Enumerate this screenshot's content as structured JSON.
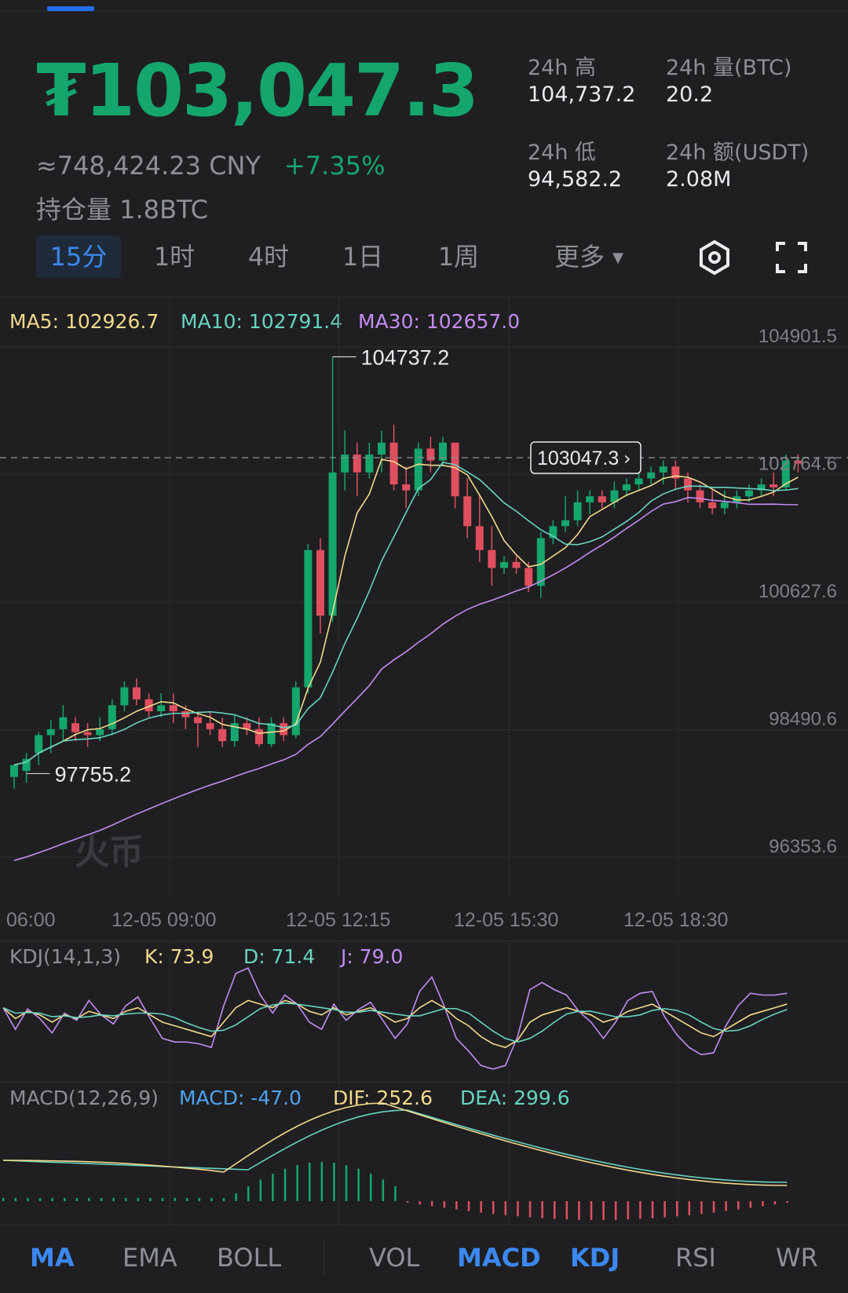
{
  "header": {
    "price": "₮103,047.3",
    "price_cny": "≈748,424.23 CNY",
    "change_pct": "+7.35%",
    "position": "持仓量 1.8BTC",
    "stats": [
      {
        "label": "24h 高",
        "value": "104,737.2"
      },
      {
        "label": "24h 量(BTC)",
        "value": "20.2"
      },
      {
        "label": "24h 低",
        "value": "94,582.2"
      },
      {
        "label": "24h 额(USDT)",
        "value": "2.08M"
      }
    ]
  },
  "intervals": [
    {
      "label": "15分",
      "active": true
    },
    {
      "label": "1时"
    },
    {
      "label": "4时"
    },
    {
      "label": "1日"
    },
    {
      "label": "1周"
    },
    {
      "label": "更多"
    }
  ],
  "icons": {
    "settings": "settings-icon",
    "fullscreen": "fullscreen-icon",
    "more": "caret-down-icon"
  },
  "ma": {
    "ma5": "MA5: 102926.7",
    "ma10": "MA10: 102791.4",
    "ma30": "MA30: 102657.0"
  },
  "price_axis": [
    "104901.5",
    "102764.6",
    "100627.6",
    "98490.6",
    "96353.6"
  ],
  "high_label": "104737.2",
  "low_label": "97755.2",
  "current_price_tag": "103047.3",
  "watermark": "火币",
  "time_axis": [
    "06:00",
    "12-05 09:00",
    "12-05 12:15",
    "12-05 15:30",
    "12-05 18:30"
  ],
  "kdj": {
    "title": "KDJ(14,1,3)",
    "k": "K: 73.9",
    "d": "D: 71.4",
    "j": "J: 79.0"
  },
  "macd": {
    "title": "MACD(12,26,9)",
    "macd": "MACD: -47.0",
    "dif": "DIF: 252.6",
    "dea": "DEA: 299.6"
  },
  "bottom_tabs": [
    {
      "label": "MA",
      "on": true
    },
    {
      "label": "EMA"
    },
    {
      "label": "BOLL"
    },
    {
      "label": "VOL"
    },
    {
      "label": "MACD",
      "on": true
    },
    {
      "label": "KDJ",
      "on": true
    },
    {
      "label": "RSI"
    },
    {
      "label": "WR"
    }
  ],
  "colors": {
    "up": "#14a66c",
    "down": "#e04f5f",
    "ma5": "#f3d98b",
    "ma10": "#67d3c2",
    "ma30": "#c58bf2",
    "accent": "#3c88f0"
  },
  "chart_data": {
    "type": "candlestick",
    "ylim": [
      96353.6,
      104901.5
    ],
    "candles": [
      [
        97700,
        97900,
        97500,
        97800
      ],
      [
        97800,
        98000,
        97600,
        98100
      ],
      [
        98100,
        98400,
        97900,
        98450
      ],
      [
        98400,
        98500,
        98100,
        98650
      ],
      [
        98500,
        98700,
        98300,
        98900
      ],
      [
        98600,
        98450,
        98300,
        98700
      ],
      [
        98450,
        98400,
        98200,
        98600
      ],
      [
        98400,
        98500,
        98300,
        98700
      ],
      [
        98500,
        98900,
        98400,
        99000
      ],
      [
        98900,
        99200,
        98800,
        99300
      ],
      [
        99200,
        99000,
        98900,
        99350
      ],
      [
        99000,
        98800,
        98700,
        99100
      ],
      [
        98800,
        98900,
        98700,
        99100
      ],
      [
        98900,
        98800,
        98600,
        99100
      ],
      [
        98800,
        98700,
        98500,
        98900
      ],
      [
        98700,
        98600,
        98200,
        98800
      ],
      [
        98600,
        98500,
        98400,
        98800
      ],
      [
        98500,
        98300,
        98200,
        98700
      ],
      [
        98300,
        98600,
        98200,
        98750
      ],
      [
        98600,
        98500,
        98400,
        98700
      ],
      [
        98500,
        98250,
        98200,
        98700
      ],
      [
        98250,
        98600,
        98200,
        98700
      ],
      [
        98600,
        98400,
        98300,
        98700
      ],
      [
        98400,
        99200,
        98350,
        99300
      ],
      [
        99200,
        101500,
        99100,
        101600
      ],
      [
        101500,
        100400,
        100100,
        101700
      ],
      [
        100400,
        102800,
        100300,
        104737.2
      ],
      [
        102800,
        103100,
        102500,
        103500
      ],
      [
        103100,
        102800,
        102400,
        103300
      ],
      [
        102800,
        103100,
        102700,
        103300
      ],
      [
        103100,
        103300,
        102800,
        103500
      ],
      [
        103300,
        102600,
        102500,
        103600
      ],
      [
        102600,
        102500,
        102200,
        102900
      ],
      [
        102500,
        103200,
        102400,
        103300
      ],
      [
        103200,
        103000,
        102800,
        103400
      ],
      [
        103000,
        103300,
        102900,
        103400
      ],
      [
        103300,
        102400,
        102200,
        103300
      ],
      [
        102400,
        101900,
        101700,
        102700
      ],
      [
        101900,
        101500,
        101300,
        102400
      ],
      [
        101500,
        101200,
        100900,
        101900
      ],
      [
        101200,
        101300,
        101100,
        101400
      ],
      [
        101300,
        101200,
        101100,
        101400
      ],
      [
        101200,
        100900,
        100800,
        101300
      ],
      [
        100900,
        101700,
        100700,
        101800
      ],
      [
        101700,
        101900,
        101600,
        102000
      ],
      [
        101900,
        102000,
        101800,
        102400
      ],
      [
        102000,
        102300,
        101900,
        102500
      ],
      [
        102300,
        102400,
        102100,
        102500
      ],
      [
        102400,
        102300,
        102200,
        102500
      ],
      [
        102300,
        102500,
        102200,
        102650
      ],
      [
        102500,
        102600,
        102400,
        102700
      ],
      [
        102600,
        102700,
        102500,
        102800
      ],
      [
        102700,
        102800,
        102600,
        102900
      ],
      [
        102800,
        102900,
        102600,
        103000
      ],
      [
        102900,
        102700,
        102500,
        103000
      ],
      [
        102700,
        102500,
        102300,
        102800
      ],
      [
        102500,
        102300,
        102200,
        102600
      ],
      [
        102300,
        102200,
        102100,
        102500
      ],
      [
        102200,
        102300,
        102100,
        102500
      ],
      [
        102300,
        102400,
        102200,
        102500
      ],
      [
        102400,
        102500,
        102300,
        102600
      ],
      [
        102500,
        102600,
        102400,
        102700
      ],
      [
        102600,
        102550,
        102400,
        102800
      ],
      [
        102550,
        103000,
        102500,
        103100
      ],
      [
        103000,
        102950,
        102800,
        103100
      ]
    ]
  }
}
